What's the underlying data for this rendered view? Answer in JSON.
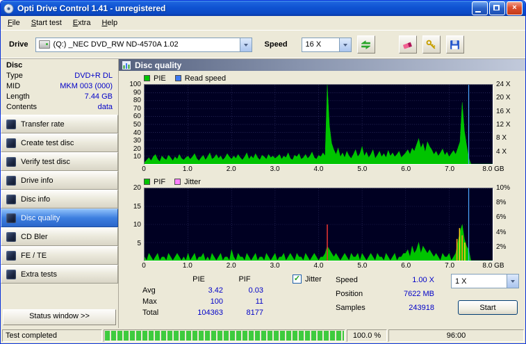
{
  "window": {
    "title": "Opti Drive Control 1.41 - unregistered"
  },
  "icons": {
    "check": "✓",
    "close": "×"
  },
  "menu": {
    "items": [
      "File",
      "Start test",
      "Extra",
      "Help"
    ]
  },
  "toolbar": {
    "drive_label": "Drive",
    "drive_value": "(Q:)  _NEC DVD_RW ND-4570A 1.02",
    "speed_label": "Speed",
    "speed_value": "16 X"
  },
  "sidebar": {
    "header": "Disc",
    "info": [
      {
        "label": "Type",
        "value": "DVD+R DL"
      },
      {
        "label": "MID",
        "value": "MKM 003 (000)"
      },
      {
        "label": "Length",
        "value": "7.44 GB"
      },
      {
        "label": "Contents",
        "value": "data"
      }
    ],
    "buttons": [
      "Transfer rate",
      "Create test disc",
      "Verify test disc",
      "Drive info",
      "Disc info",
      "Disc quality",
      "CD Bler",
      "FE / TE",
      "Extra tests"
    ],
    "selected_index": 5,
    "status_window_label": "Status window >>"
  },
  "panel": {
    "header": "Disc quality"
  },
  "stats": {
    "pie_header": "PIE",
    "pif_header": "PIF",
    "rows": [
      {
        "label": "Avg",
        "pie": "3.42",
        "pif": "0.03"
      },
      {
        "label": "Max",
        "pie": "100",
        "pif": "11"
      },
      {
        "label": "Total",
        "pie": "104363",
        "pif": "8177"
      }
    ],
    "jitter_label": "Jitter",
    "jitter_checked": true,
    "speed_label": "Speed",
    "speed_value": "1.00 X",
    "position_label": "Position",
    "position_value": "7622 MB",
    "samples_label": "Samples",
    "samples_value": "243918",
    "write_speed_value": "1 X",
    "start_button": "Start"
  },
  "statusbar": {
    "left": "Test completed",
    "progress": "100.0 %",
    "percent": 100,
    "time": "96:00"
  },
  "colors": {
    "pie_green": "#00c400",
    "read_speed_blue": "#3c78f0",
    "jitter_pink": "#ff80ff",
    "value_text_blue": "#0000c8",
    "plot_background": "#000022"
  },
  "chart_data": [
    {
      "type": "area",
      "name": "PIE / Read speed",
      "legend": [
        {
          "label": "PIE",
          "color": "#00c400"
        },
        {
          "label": "Read speed",
          "color": "#3c78f0"
        }
      ],
      "ymax": 100,
      "yticks_left": [
        100,
        90,
        80,
        70,
        60,
        50,
        40,
        30,
        20,
        10
      ],
      "right_max": 24,
      "yticks_right": [
        {
          "v": 24,
          "label": "24 X"
        },
        {
          "v": 20,
          "label": "20 X"
        },
        {
          "v": 16,
          "label": "16 X"
        },
        {
          "v": 12,
          "label": "12 X"
        },
        {
          "v": 8,
          "label": "8 X"
        },
        {
          "v": 4,
          "label": "4 X"
        }
      ],
      "xmax": 8,
      "xticks": [
        {
          "v": 0,
          "label": "0"
        },
        {
          "v": 1,
          "label": "1.0"
        },
        {
          "v": 2,
          "label": "2.0"
        },
        {
          "v": 3,
          "label": "3.0"
        },
        {
          "v": 4,
          "label": "4.0"
        },
        {
          "v": 5,
          "label": "5.0"
        },
        {
          "v": 6,
          "label": "6.0"
        },
        {
          "v": 7,
          "label": "7.0"
        },
        {
          "v": 8,
          "label": "8.0 GB"
        }
      ],
      "series": [
        {
          "name": "PIE",
          "color": "#00c400",
          "values": [
            2,
            5,
            8,
            4,
            9,
            12,
            6,
            3,
            10,
            7,
            5,
            11,
            8,
            4,
            9,
            6,
            12,
            7,
            5,
            8,
            10,
            6,
            9,
            13,
            7,
            4,
            8,
            11,
            5,
            9,
            14,
            6,
            8,
            12,
            7,
            10,
            5,
            8,
            13,
            9,
            6,
            10,
            7,
            12,
            8,
            5,
            9,
            14,
            6,
            10,
            7,
            13,
            8,
            5,
            11,
            9,
            6,
            12,
            8,
            10,
            7,
            9,
            12,
            6,
            10,
            8,
            14,
            7,
            5,
            11,
            9,
            13,
            6,
            8,
            12,
            7,
            10,
            15,
            8,
            6,
            11,
            9,
            14,
            10,
            100,
            48,
            26,
            18,
            12,
            20,
            9,
            14,
            8,
            16,
            10,
            7,
            12,
            18,
            9,
            13,
            22,
            10,
            15,
            8,
            12,
            18,
            7,
            11,
            16,
            9,
            13,
            8,
            17,
            10,
            14,
            9,
            12,
            16,
            8,
            11,
            14,
            18,
            12,
            20,
            16,
            24,
            32,
            20,
            26,
            15,
            28,
            22,
            18,
            12,
            16,
            10,
            14,
            19,
            11,
            15,
            9,
            13,
            17,
            12,
            20,
            28,
            78,
            42,
            24,
            8,
            0,
            0,
            0,
            0,
            0,
            0,
            0,
            0,
            0,
            0,
            0
          ]
        }
      ],
      "spikes": [],
      "marker": {
        "x": 7.45,
        "color": "#4da6ff"
      }
    },
    {
      "type": "area",
      "name": "PIF / Jitter",
      "legend": [
        {
          "label": "PIF",
          "color": "#00c400"
        },
        {
          "label": "Jitter",
          "color": "#ff80ff"
        }
      ],
      "ymax": 20,
      "yticks_left": [
        20,
        15,
        10,
        5
      ],
      "right_max": 10,
      "yticks_right": [
        {
          "v": 10,
          "label": "10%"
        },
        {
          "v": 8,
          "label": "8%"
        },
        {
          "v": 6,
          "label": "6%"
        },
        {
          "v": 4,
          "label": "4%"
        },
        {
          "v": 2,
          "label": "2%"
        }
      ],
      "xmax": 8,
      "xticks": [
        {
          "v": 0,
          "label": "0"
        },
        {
          "v": 1,
          "label": "1.0"
        },
        {
          "v": 2,
          "label": "2.0"
        },
        {
          "v": 3,
          "label": "3.0"
        },
        {
          "v": 4,
          "label": "4.0"
        },
        {
          "v": 5,
          "label": "5.0"
        },
        {
          "v": 6,
          "label": "6.0"
        },
        {
          "v": 7,
          "label": "7.0"
        },
        {
          "v": 8,
          "label": "8.0 GB"
        }
      ],
      "series": [
        {
          "name": "PIF",
          "color": "#00c400",
          "values": [
            1,
            0,
            2,
            1,
            0,
            1,
            2,
            0,
            1,
            1,
            0,
            2,
            1,
            0,
            1,
            2,
            1,
            0,
            1,
            0,
            2,
            0,
            1,
            2,
            0,
            1,
            1,
            2,
            0,
            1,
            0,
            2,
            1,
            0,
            1,
            2,
            0,
            1,
            1,
            0,
            3,
            1,
            0,
            2,
            1,
            1,
            0,
            2,
            1,
            0,
            1,
            2,
            0,
            1,
            1,
            0,
            2,
            1,
            0,
            1,
            2,
            0,
            1,
            1,
            2,
            0,
            1,
            2,
            1,
            0,
            2,
            1,
            1,
            0,
            2,
            1,
            0,
            1,
            2,
            1,
            0,
            1,
            1,
            2,
            4,
            3,
            2,
            1,
            2,
            1,
            0,
            1,
            2,
            1,
            0,
            2,
            1,
            1,
            2,
            0,
            2,
            1,
            0,
            1,
            2,
            1,
            0,
            2,
            1,
            1,
            0,
            2,
            1,
            0,
            1,
            2,
            0,
            1,
            1,
            2,
            2,
            3,
            1,
            4,
            2,
            3,
            5,
            2,
            4,
            3,
            2,
            3,
            2,
            1,
            2,
            1,
            0,
            2,
            1,
            1,
            2,
            0,
            1,
            2,
            5,
            8,
            10,
            6,
            4,
            3,
            0,
            0,
            0,
            0,
            0,
            0,
            0,
            0,
            0,
            0,
            0
          ]
        }
      ],
      "spikes": [
        {
          "x": 4.2,
          "v": 10,
          "color": "#e03232"
        },
        {
          "x": 7.18,
          "v": 6,
          "color": "#ff9b1a"
        },
        {
          "x": 7.24,
          "v": 9,
          "color": "#ffd21a"
        },
        {
          "x": 7.3,
          "v": 7,
          "color": "#ff9b1a"
        },
        {
          "x": 7.36,
          "v": 5,
          "color": "#ffd21a"
        }
      ],
      "marker": {
        "x": 7.45,
        "color": "#4da6ff"
      }
    }
  ]
}
